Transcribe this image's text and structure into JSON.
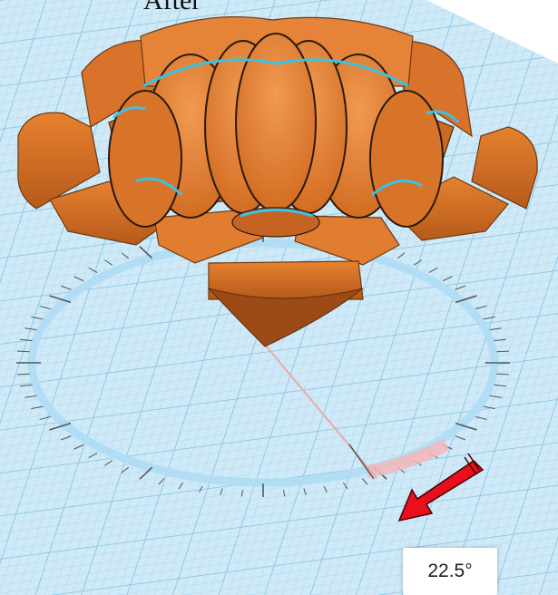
{
  "caption": "After",
  "rotation": {
    "angle_label": "22.5°",
    "angle_degrees": 22.5
  },
  "icons": {
    "arrow": "red-arrow-icon"
  },
  "colors": {
    "workplane": "#c9e8f7",
    "grid_fine": "#a9d6ee",
    "grid_major": "#7fc0e4",
    "petal": "#e07b2a",
    "petal_dark": "#a9531a",
    "petal_light": "#f0954b",
    "selection_outline": "#39c3e6",
    "rotation_ring": "#aeddf4",
    "angle_arc": "#f4b6b6",
    "arrow": "#e8101a"
  }
}
